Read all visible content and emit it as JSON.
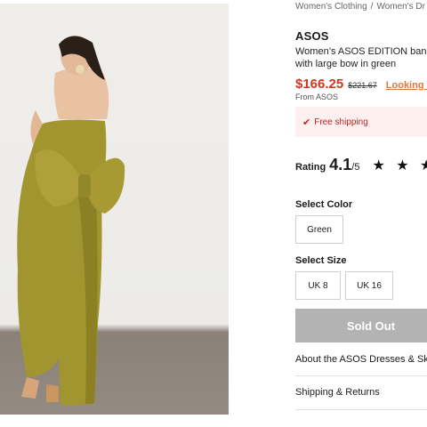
{
  "breadcrumb": [
    "Women's Clothing",
    "Women's Dr"
  ],
  "breadcrumb_sep": "/",
  "product": {
    "brand": "ASOS",
    "title": "Women’s ASOS EDITION band with large bow in green",
    "price": "$166.25",
    "original_price": "$221.67",
    "promo_link": "Looking fo",
    "seller": "From ASOS"
  },
  "shipping": {
    "icon": "✔",
    "text": "Free shipping"
  },
  "rating": {
    "label": "Rating",
    "value": "4.1",
    "out_of": "/5",
    "stars": "★ ★ ★"
  },
  "color": {
    "label": "Select Color",
    "options": [
      "Green"
    ]
  },
  "size": {
    "label": "Select Size",
    "options": [
      "UK 8",
      "UK 16"
    ]
  },
  "buy_button": "Sold Out",
  "accordion": [
    "About the ASOS Dresses & Sk",
    "Shipping & Returns"
  ],
  "colors": {
    "price_red": "#d2361e",
    "promo_orange": "#e0783d",
    "shipping_bg": "#fdf0ee",
    "button_gray": "#b3b3b3",
    "dress": "#9e9130"
  }
}
